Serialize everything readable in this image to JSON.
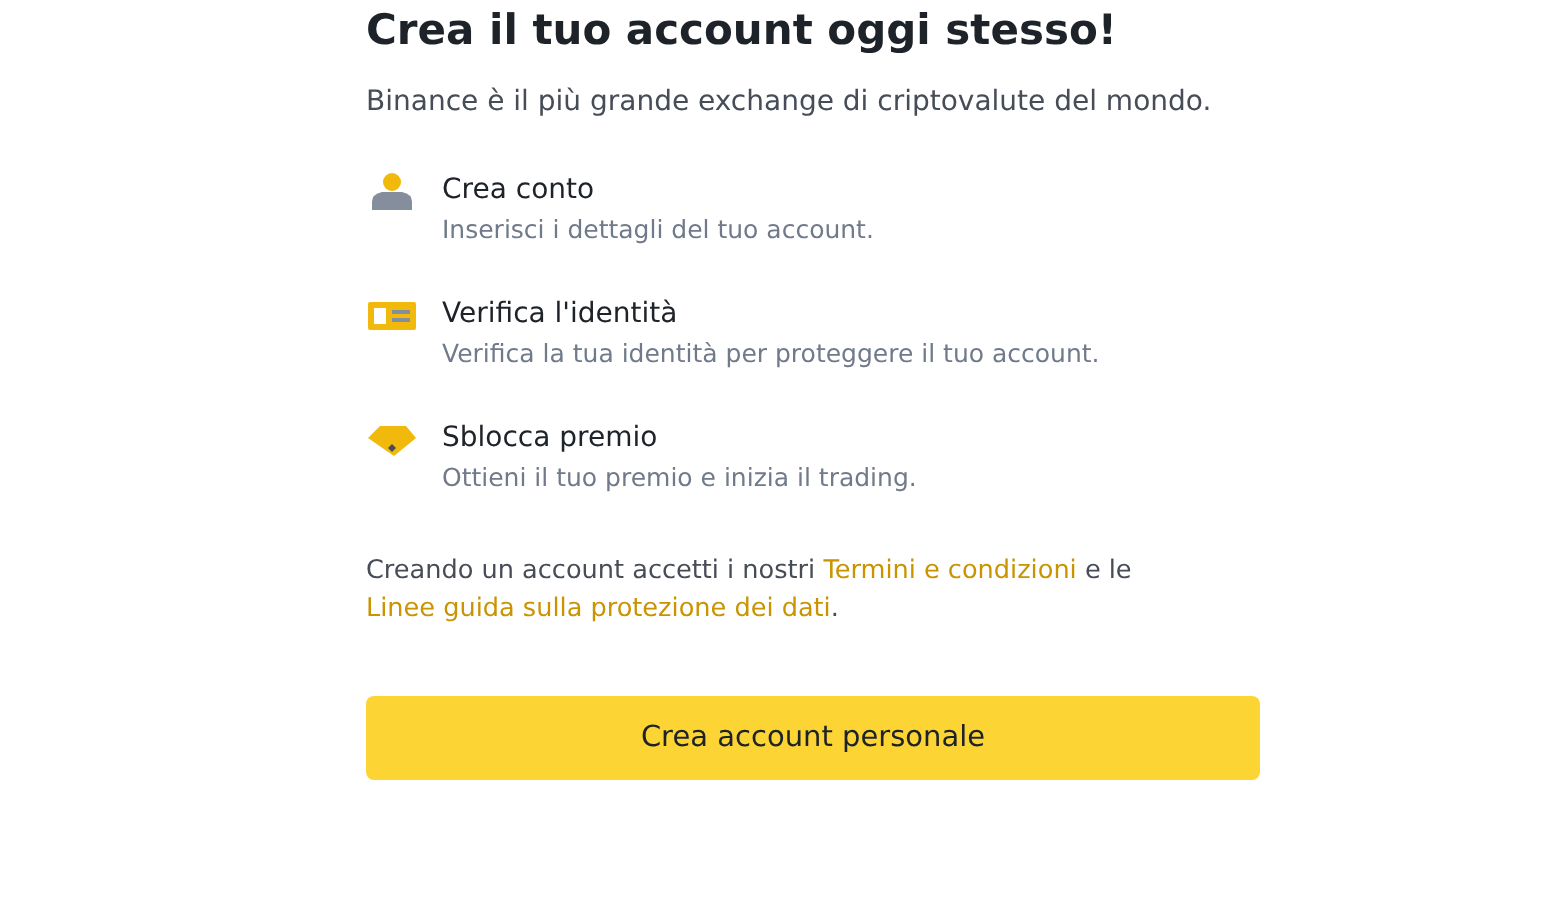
{
  "title": "Crea il tuo account oggi stesso!",
  "subtitle": "Binance è il più grande exchange di criptovalute del mondo.",
  "steps": [
    {
      "kind": "user",
      "title": "Crea conto",
      "description": "Inserisci i dettagli del tuo account."
    },
    {
      "kind": "id-card",
      "title": "Verifica l'identità",
      "description": "Verifica la tua identità per proteggere il tuo account."
    },
    {
      "kind": "gift",
      "title": "Sblocca premio",
      "description": "Ottieni il tuo premio e inizia il trading."
    }
  ],
  "legal": [
    {
      "kind": "text",
      "text": "Creando un account accetti i nostri"
    },
    {
      "kind": "link",
      "text": "Termini e condizioni"
    },
    {
      "kind": "text",
      "text": "e le"
    },
    {
      "kind": "link",
      "text": "Linee guida sulla protezione dei dati"
    },
    {
      "kind": "text",
      "text": "."
    }
  ],
  "button": {
    "label": "Crea account personale"
  }
}
